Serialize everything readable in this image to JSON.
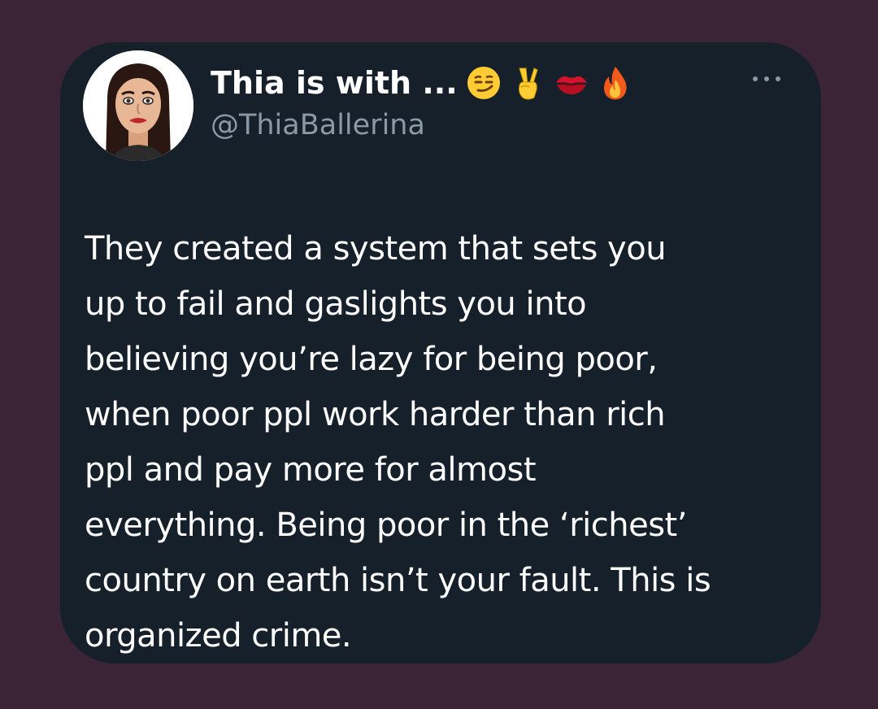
{
  "tweet": {
    "author": {
      "display_name": "Thia is with ...",
      "handle": "@ThiaBallerina",
      "name_emojis": [
        "smirking-face-emoji",
        "victory-hand-emoji",
        "kiss-mark-emoji",
        "fire-emoji"
      ],
      "avatar_icon": "bitmoji-woman-avatar"
    },
    "more_icon": "more-options-icon",
    "text_lines": [
      "They created a system that sets you",
      "up to fail and gaslights you into",
      "believing you’re lazy for being poor,",
      "when poor ppl work harder than rich",
      "ppl and pay more for almost",
      "everything. Being poor in the ‘richest’",
      "country on earth isn’t your fault. This is",
      "organized crime."
    ]
  },
  "colors": {
    "page_background": "#3a2435",
    "card_background": "#16202b",
    "primary_text": "#ffffff",
    "secondary_text": "#8b98a5"
  }
}
